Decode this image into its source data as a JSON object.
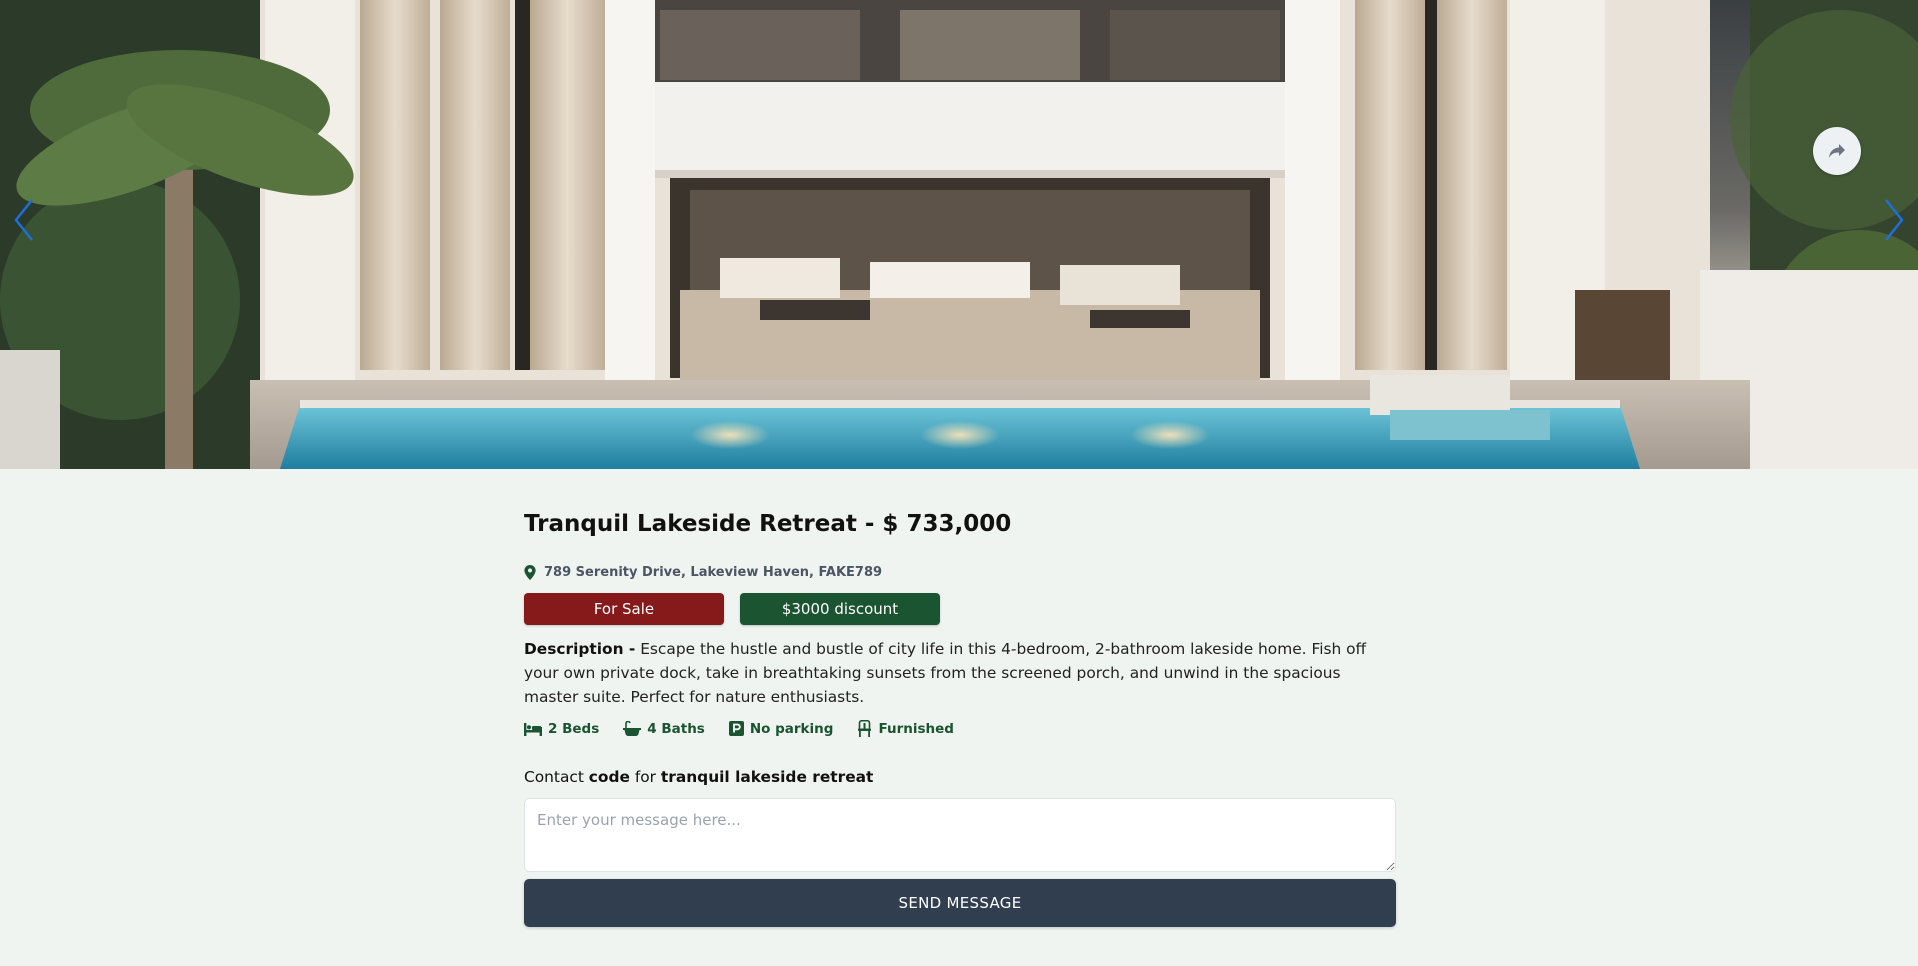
{
  "listing": {
    "title": "Tranquil Lakeside Retreat - $ 733,000",
    "address": "789 Serenity Drive, Lakeview Haven, FAKE789",
    "status_badge": "For Sale",
    "discount_badge": "$3000 discount",
    "description_label": "Description -",
    "description_text": " Escape the hustle and bustle of city life in this 4-bedroom, 2-bathroom lakeside home. Fish off your own private dock, take in breathtaking sunsets from the screened porch, and unwind in the spacious master suite. Perfect for nature enthusiasts.",
    "features": [
      {
        "icon": "bed-icon",
        "label": "2 Beds"
      },
      {
        "icon": "bath-icon",
        "label": "4 Baths"
      },
      {
        "icon": "parking-icon",
        "label": "No parking"
      },
      {
        "icon": "chair-icon",
        "label": "Furnished"
      }
    ]
  },
  "contact": {
    "prefix": "Contact ",
    "agent": "code",
    "middle": " for ",
    "property": "tranquil lakeside retreat",
    "placeholder": "Enter your message here...",
    "send_label": "SEND MESSAGE"
  },
  "carousel": {
    "image": "luxury-villa-photo",
    "prev_icon": "chevron-left-icon",
    "next_icon": "chevron-right-icon",
    "share_icon": "share-icon"
  },
  "colors": {
    "background": "#eff4f0",
    "sale_badge": "#861a1a",
    "discount_badge": "#1a5430",
    "feature_text": "#1a5430",
    "button": "#303e50",
    "arrow": "#1e6fd9"
  }
}
